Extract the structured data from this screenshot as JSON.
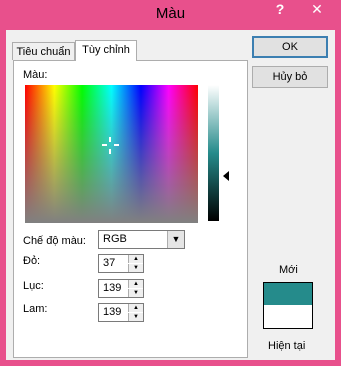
{
  "window": {
    "title": "Màu",
    "help": "?",
    "close": "✕"
  },
  "tabs": [
    {
      "label": "Tiêu chuẩn"
    },
    {
      "label": "Tùy chỉnh"
    }
  ],
  "custom": {
    "colors_label": "Màu:",
    "color_model_label": "Chế độ màu:",
    "color_model_value": "RGB",
    "red_label": "Đỏ:",
    "red_value": "37",
    "green_label": "Lục:",
    "green_value": "139",
    "blue_label": "Lam:",
    "blue_value": "139"
  },
  "buttons": {
    "ok": "OK",
    "cancel": "Hủy bỏ"
  },
  "preview": {
    "new_label": "Mới",
    "current_label": "Hiện tại"
  },
  "colors": {
    "new": "#258b8b",
    "current": "#ffffff",
    "titlebar": "#e8508c"
  }
}
